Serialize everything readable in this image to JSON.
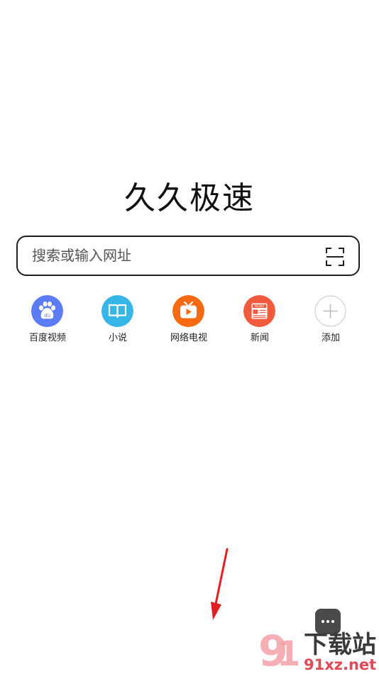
{
  "app": {
    "title": "久久极速"
  },
  "search": {
    "placeholder": "搜索或输入网址"
  },
  "shortcuts": [
    {
      "label": "百度视频",
      "icon": "baidu-paw-icon",
      "color": "#5b7cf4"
    },
    {
      "label": "小说",
      "icon": "book-icon",
      "color": "#35b6e6"
    },
    {
      "label": "网络电视",
      "icon": "tv-play-icon",
      "color": "#f76a12"
    },
    {
      "label": "新闻",
      "icon": "news-icon",
      "color": "#f25a3d"
    },
    {
      "label": "添加",
      "icon": "plus-icon",
      "color": "#cccccc"
    }
  ],
  "annotation": {
    "arrow_color": "#e02020"
  },
  "watermark": {
    "brand": "下载站",
    "domain": "91xz.net"
  }
}
